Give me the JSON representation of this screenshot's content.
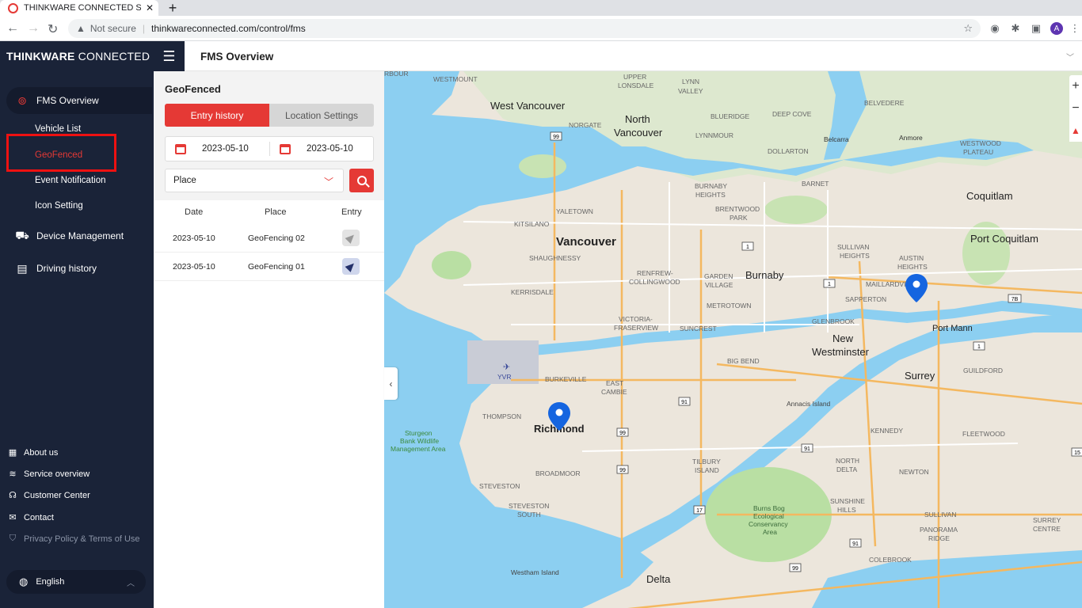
{
  "browser": {
    "tab_title": "THINKWARE CONNECTED Service",
    "tab_close": "✕",
    "new_tab": "+",
    "not_secure": "Not secure",
    "url": "thinkwareconnected.com/control/fms",
    "profile_initial": "A"
  },
  "sidebar": {
    "logo_bold": "THINKWARE",
    "logo_light": "CONNECTED",
    "items": [
      {
        "label": "FMS Overview",
        "icon": "location-pin-icon"
      },
      {
        "label": "Device Management",
        "icon": "car-icon"
      },
      {
        "label": "Driving history",
        "icon": "document-icon"
      }
    ],
    "sub_items": [
      {
        "label": "Vehicle List"
      },
      {
        "label": "GeoFenced"
      },
      {
        "label": "Event Notification"
      },
      {
        "label": "Icon Setting"
      }
    ],
    "footer": [
      {
        "label": "About us",
        "icon": "building-icon"
      },
      {
        "label": "Service overview",
        "icon": "layers-icon"
      },
      {
        "label": "Customer Center",
        "icon": "headset-icon"
      },
      {
        "label": "Contact",
        "icon": "mail-icon"
      },
      {
        "label": "Privacy Policy & Terms of Use",
        "icon": "shield-icon"
      }
    ],
    "language": "English"
  },
  "header": {
    "title": "FMS Overview"
  },
  "panel": {
    "title": "GeoFenced",
    "tabs": [
      "Entry history",
      "Location Settings"
    ],
    "start_date": "2023-05-10",
    "end_date": "2023-05-10",
    "place_select": "Place",
    "table": {
      "headers": [
        "Date",
        "Place",
        "Entry"
      ],
      "rows": [
        {
          "date": "2023-05-10",
          "place": "GeoFencing 02",
          "entry": "grey"
        },
        {
          "date": "2023-05-10",
          "place": "GeoFencing 01",
          "entry": "blue"
        }
      ]
    }
  },
  "map": {
    "labels_major": [
      "West Vancouver",
      "North Vancouver",
      "Vancouver",
      "Burnaby",
      "Coquitlam",
      "Port Coquitlam",
      "New Westminster",
      "Surrey",
      "Richmond",
      "Delta",
      "Port Mann"
    ],
    "labels_minor": [
      "WESTMOUNT",
      "UPPER LONSDALE",
      "LYNN VALLEY",
      "BELVEDERE",
      "NORGATE",
      "BLUERIDGE",
      "DEEP COVE",
      "LYNNMOUR",
      "DOLLARTON",
      "Belcarra",
      "Anmore",
      "WESTWOOD PLATEAU",
      "BARNET",
      "BURNABY HEIGHTS",
      "YALETOWN",
      "BRENTWOOD PARK",
      "KITSILANO",
      "SHAUGHNESSY",
      "SULLIVAN HEIGHTS",
      "AUSTIN HEIGHTS",
      "RENFREW-COLLINGWOOD",
      "GARDEN VILLAGE",
      "MAILLARDVILLE",
      "KERRISDALE",
      "SAPPERTON",
      "METROTOWN",
      "VICTORIA-FRASERVIEW",
      "SUNCREST",
      "GLENBROOK",
      "BIG BEND",
      "YVR",
      "BURKEVILLE",
      "EAST CAMBIE",
      "GUILDFORD",
      "THOMPSON",
      "Annacis Island",
      "KENNEDY",
      "FLEETWOOD",
      "Sturgeon Bank Wildlife Management Area",
      "BROADMOOR",
      "TILBURY ISLAND",
      "NORTH DELTA",
      "NEWTON",
      "STEVESTON",
      "STEVESTON SOUTH",
      "Burns Bog Ecological Conservancy Area",
      "SUNSHINE HILLS",
      "SULLIVAN",
      "PANORAMA RIDGE",
      "SURREY CENTRE",
      "COLEBROOK",
      "Westham Island",
      "RBOUR"
    ],
    "highways": [
      "99",
      "1",
      "1",
      "7B",
      "1",
      "91",
      "99",
      "91",
      "99",
      "17",
      "91",
      "99",
      "15"
    ]
  },
  "colors": {
    "accent": "#e53935",
    "sidebar_bg": "#1a2338",
    "water": "#8ccff1",
    "land": "#ece6dc",
    "park": "#b9dfa3",
    "pin": "#1565e0"
  }
}
